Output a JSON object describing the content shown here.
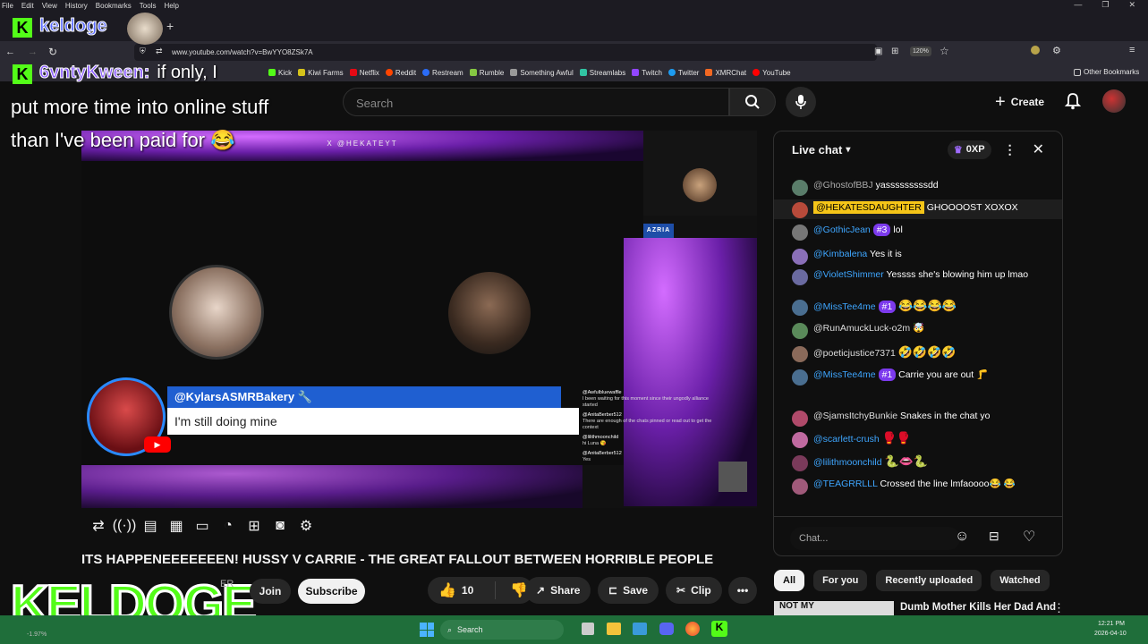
{
  "browser": {
    "menu": [
      "File",
      "Edit",
      "View",
      "History",
      "Bookmarks",
      "Tools",
      "Help"
    ],
    "url": "www.youtube.com/watch?v=BwYYO8ZSk7A",
    "zoom": "120%",
    "bookmarks": [
      {
        "label": "Kick",
        "color": "#53fc18"
      },
      {
        "label": "Kiwi Farms",
        "color": "#d4c21a"
      },
      {
        "label": "Netflix",
        "color": "#e50914"
      },
      {
        "label": "Reddit",
        "color": "#ff4500"
      },
      {
        "label": "Restream",
        "color": "#2b6cf6"
      },
      {
        "label": "Rumble",
        "color": "#85c742"
      },
      {
        "label": "Something Awful",
        "color": "#999999"
      },
      {
        "label": "Streamlabs",
        "color": "#31c3a2"
      },
      {
        "label": "Twitch",
        "color": "#9146ff"
      },
      {
        "label": "Twitter",
        "color": "#1d9bf0"
      },
      {
        "label": "XMRChat",
        "color": "#f26822"
      },
      {
        "label": "YouTube",
        "color": "#ff0000"
      }
    ],
    "other_bookmarks": "Other Bookmarks"
  },
  "youtube": {
    "search_placeholder": "Search",
    "create_label": "Create",
    "video_title": "ITS HAPPENEEEEEEEN! HUSSY V CARRIE - THE GREAT FALLOUT BETWEEN HORRIBLE PEOPLE",
    "channel_partial": "ER",
    "join_label": "Join",
    "subscribe_label": "Subscribe",
    "like_count": "10",
    "share_label": "Share",
    "save_label": "Save",
    "clip_label": "Clip"
  },
  "video_scene": {
    "handle": "X @HEKATEYT",
    "tag": "AZRIA",
    "lower_third_name": "@KylarsASMRBakery 🔧",
    "lower_third_text": "I'm still doing mine",
    "mini_chat": [
      {
        "name": "@Awfulbluewaffle",
        "text": "I been waiting for this moment since their ungodly alliance started"
      },
      {
        "name": "@AnitaBerber512",
        "text": "There are enough of the chats pinned or read out to get the context"
      },
      {
        "name": "@lilithmoonchild",
        "text": "hi Luna 😘"
      },
      {
        "name": "@AnitaBerber512",
        "text": "Yes"
      }
    ]
  },
  "overlay": {
    "kick_name": "keldoge",
    "commenter": "6vntyKween:",
    "message_line1": "if only, I",
    "message_rest": "put more time into online stuff than I've been paid for 😂",
    "brand": "KELDOGE"
  },
  "chat": {
    "title": "Live chat",
    "xp": "0XP",
    "input_placeholder": "Chat...",
    "messages": [
      {
        "name": "@GhostofBBJ",
        "text": "yasssssssssdd",
        "badge": "",
        "avatar": "#5a7d6a"
      },
      {
        "name": "@HEKATESDAUGHTER",
        "text": "GHOOOOST XOXOX",
        "badge": "",
        "avatar": "#b84a3a",
        "highlight": true
      },
      {
        "name": "@GothicJean",
        "text": "lol",
        "badge": "#3",
        "avatar": "#777"
      },
      {
        "name": "@Kimbalena",
        "text": "Yes it is",
        "badge": "",
        "avatar": "#8a6fb8"
      },
      {
        "name": "@VioletShimmer",
        "text": "Yessss she's blowing him up lmao",
        "badge": "",
        "avatar": "#6a6aa0"
      },
      {
        "name": "@MissTee4me",
        "text": "😂😂😂😂",
        "badge": "#1",
        "avatar": "#4a6e90"
      },
      {
        "name": "@RunAmuckLuck-o2m",
        "text": "🤯",
        "badge": "",
        "avatar": "#5a8a5a"
      },
      {
        "name": "@poeticjustice7371",
        "text": "🤣🤣🤣🤣",
        "badge": "",
        "avatar": "#8a6a5a"
      },
      {
        "name": "@MissTee4me",
        "text": "Carrie you are out 🦵",
        "badge": "#1",
        "avatar": "#4a6e90"
      },
      {
        "name": "@SjamsItchyBunkie",
        "text": "Snakes in the chat yo",
        "badge": "",
        "avatar": "#b04a6a"
      },
      {
        "name": "@scarlett-crush",
        "text": "🥊🥊",
        "badge": "",
        "avatar": "#c06aa0"
      },
      {
        "name": "@lilithmoonchild",
        "text": "🐍👄🐍",
        "badge": "",
        "avatar": "#7a3a5a"
      },
      {
        "name": "@TEAGRRLLL",
        "text": "Crossed the line lmfaoooo😂 😂",
        "badge": "",
        "avatar": "#a05a7a"
      }
    ]
  },
  "chips": [
    "All",
    "For you",
    "Recently uploaded",
    "Watched"
  ],
  "rec": {
    "title": "Dumb Mother Kills Her Dad And",
    "thumb_text": "NOT MY"
  },
  "taskbar": {
    "search": "Search",
    "time": "12:21 PM",
    "date": "2026-04-10",
    "stat": "-1.97%"
  },
  "colors": {
    "accent": "#3ea6ff",
    "kick": "#53fc18",
    "youtube_red": "#ff0000",
    "purple": "#7c3aed"
  }
}
